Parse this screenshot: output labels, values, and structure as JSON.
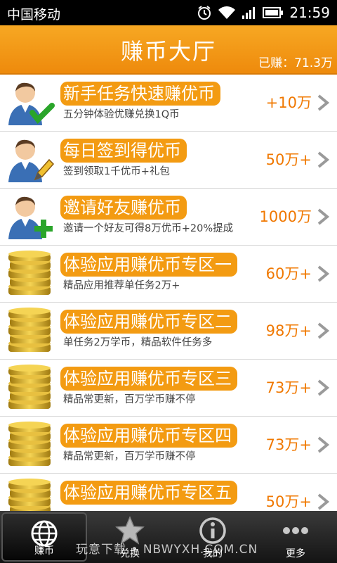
{
  "status_bar": {
    "carrier": "中国移动",
    "time": "21:59"
  },
  "header": {
    "title": "赚币大厅",
    "earned": "已赚：71.3万"
  },
  "tasks": [
    {
      "title": "新手任务快速赚优币",
      "desc": "五分钟体验优赚兑换1Q币",
      "reward": "+10万",
      "icon": "user-check-icon"
    },
    {
      "title": "每日签到得优币",
      "desc": "签到领取1千优币+礼包",
      "reward": "50万+",
      "icon": "user-edit-icon"
    },
    {
      "title": "邀请好友赚优币",
      "desc": "邀请一个好友可得8万优币+20%提成",
      "reward": "1000万",
      "icon": "user-add-icon"
    },
    {
      "title": "体验应用赚优币专区一",
      "desc": "精品应用推荐单任务2万+",
      "reward": "60万+",
      "icon": "coin-stack-icon"
    },
    {
      "title": "体验应用赚优币专区二",
      "desc": "单任务2万学币，精品软件任务多",
      "reward": "98万+",
      "icon": "coin-stack-icon"
    },
    {
      "title": "体验应用赚优币专区三",
      "desc": "精品常更新，百万学币赚不停",
      "reward": "73万+",
      "icon": "coin-stack-icon"
    },
    {
      "title": "体验应用赚优币专区四",
      "desc": "精品常更新，百万学币赚不停",
      "reward": "73万+",
      "icon": "coin-stack-icon"
    },
    {
      "title": "体验应用赚优币专区五",
      "desc": "",
      "reward": "50万+",
      "icon": "coin-stack-icon"
    }
  ],
  "tabs": [
    {
      "label": "赚币",
      "icon": "globe-icon",
      "active": true
    },
    {
      "label": "兑换",
      "icon": "star-icon",
      "active": false
    },
    {
      "label": "我的",
      "icon": "info-icon",
      "active": false
    },
    {
      "label": "更多",
      "icon": "more-icon",
      "active": false
    }
  ],
  "watermark": "玩意下载 • NBWYXH.COM.CN",
  "colors": {
    "accent": "#f39b12",
    "reward": "#f07800",
    "tabbar": "#1e1e1e"
  }
}
